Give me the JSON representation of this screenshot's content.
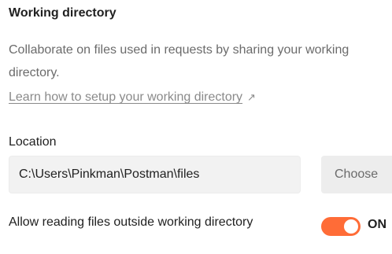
{
  "section": {
    "title": "Working directory",
    "description": "Collaborate on files used in requests by sharing your working directory.",
    "learn_link": "Learn how to setup your working directory",
    "learn_link_arrow": "↗"
  },
  "location": {
    "label": "Location",
    "value": "C:\\Users\\Pinkman\\Postman\\files",
    "choose_button": "Choose"
  },
  "outside_files": {
    "label": "Allow reading files outside working directory",
    "toggle_on": true,
    "state_text": "ON"
  },
  "colors": {
    "accent": "#ff6c37",
    "muted_text": "#6b6b6b",
    "input_background": "#f2f2f2"
  }
}
